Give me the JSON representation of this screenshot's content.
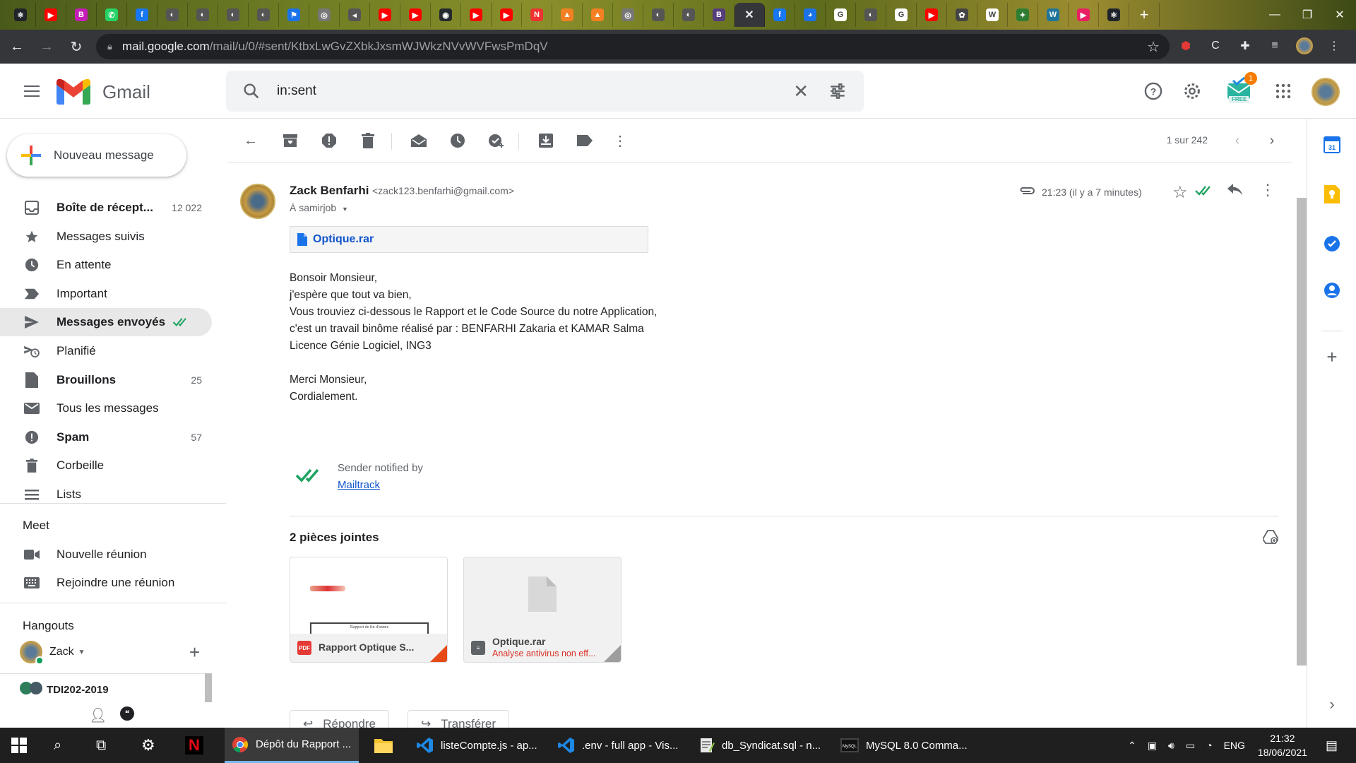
{
  "browser": {
    "tabs": [
      {
        "icon": "react-icon",
        "color": "#20232a",
        "glyph": "⚛"
      },
      {
        "icon": "youtube-icon",
        "color": "#ff0000",
        "glyph": "▶"
      },
      {
        "icon": "bootstrap-icon",
        "color": "#c51eb8",
        "glyph": "B"
      },
      {
        "icon": "whatsapp-icon",
        "color": "#25d366",
        "glyph": "✆"
      },
      {
        "icon": "facebook-icon",
        "color": "#1877f2",
        "glyph": "f"
      },
      {
        "icon": "globe-icon",
        "color": "#555",
        "glyph": "◐"
      },
      {
        "icon": "globe-icon",
        "color": "#555",
        "glyph": "◐"
      },
      {
        "icon": "globe-icon",
        "color": "#555",
        "glyph": "◐"
      },
      {
        "icon": "globe-icon",
        "color": "#555",
        "glyph": "◐"
      },
      {
        "icon": "flag-icon",
        "color": "#1a73e8",
        "glyph": "⚑"
      },
      {
        "icon": "globe-icon",
        "color": "#777",
        "glyph": "◎"
      },
      {
        "icon": "audio-icon",
        "color": "#555",
        "glyph": "◂"
      },
      {
        "icon": "youtube-icon",
        "color": "#ff0000",
        "glyph": "▶"
      },
      {
        "icon": "youtube-icon",
        "color": "#ff0000",
        "glyph": "▶"
      },
      {
        "icon": "github-icon",
        "color": "#24292e",
        "glyph": "◉"
      },
      {
        "icon": "youtube-icon",
        "color": "#ff0000",
        "glyph": "▶"
      },
      {
        "icon": "youtube-icon",
        "color": "#ff0000",
        "glyph": "▶"
      },
      {
        "icon": "news-icon",
        "color": "#e33",
        "glyph": "N"
      },
      {
        "icon": "stack-icon",
        "color": "#f48024",
        "glyph": "▲"
      },
      {
        "icon": "stack-icon",
        "color": "#f48024",
        "glyph": "▲"
      },
      {
        "icon": "globe-icon",
        "color": "#777",
        "glyph": "◎"
      },
      {
        "icon": "globe-icon",
        "color": "#555",
        "glyph": "◐"
      },
      {
        "icon": "globe-icon",
        "color": "#555",
        "glyph": "◐"
      },
      {
        "icon": "bootstrap-icon",
        "color": "#563d7c",
        "glyph": "B"
      }
    ],
    "active_tab_glyph": "✕",
    "tabs_right": [
      {
        "icon": "facebook-icon",
        "color": "#1877f2",
        "glyph": "f"
      },
      {
        "icon": "chrome-icon",
        "color": "#1a73e8",
        "glyph": "◕"
      },
      {
        "icon": "google-icon",
        "color": "#fff",
        "glyph": "G"
      },
      {
        "icon": "globe-icon",
        "color": "#555",
        "glyph": "◐"
      },
      {
        "icon": "google-icon",
        "color": "#fff",
        "glyph": "G"
      },
      {
        "icon": "youtube-icon",
        "color": "#ff0000",
        "glyph": "▶"
      },
      {
        "icon": "openai-icon",
        "color": "#444",
        "glyph": "✿"
      },
      {
        "icon": "wikipedia-icon",
        "color": "#fff",
        "glyph": "W"
      },
      {
        "icon": "leaf-icon",
        "color": "#2e7d32",
        "glyph": "✦"
      },
      {
        "icon": "wordpress-icon",
        "color": "#21759b",
        "glyph": "W"
      },
      {
        "icon": "play-icon",
        "color": "#e91e63",
        "glyph": "▶"
      },
      {
        "icon": "react-icon",
        "color": "#20232a",
        "glyph": "⚛"
      }
    ],
    "new_tab": "+",
    "url_host": "mail.google.com",
    "url_path": "/mail/u/0/#sent/KtbxLwGvZXbkJxsmWJWkzNVvWVFwsPmDqV"
  },
  "gmail": {
    "logo_text": "Gmail",
    "search_query": "in:sent",
    "addon_badge": "1",
    "addon_label": "FREE",
    "compose_label": "Nouveau message",
    "nav": [
      {
        "label": "Boîte de récept...",
        "count": "12 022",
        "bold": true,
        "icon": "inbox-icon"
      },
      {
        "label": "Messages suivis",
        "count": "",
        "bold": false,
        "icon": "star-icon"
      },
      {
        "label": "En attente",
        "count": "",
        "bold": false,
        "icon": "clock-icon"
      },
      {
        "label": "Important",
        "count": "",
        "bold": false,
        "icon": "important-icon"
      },
      {
        "label": "Messages envoyés",
        "count": "",
        "bold": true,
        "icon": "send-icon"
      },
      {
        "label": "Planifié",
        "count": "",
        "bold": false,
        "icon": "scheduled-icon"
      },
      {
        "label": "Brouillons",
        "count": "25",
        "bold": true,
        "icon": "draft-icon"
      },
      {
        "label": "Tous les messages",
        "count": "",
        "bold": false,
        "icon": "all-mail-icon"
      },
      {
        "label": "Spam",
        "count": "57",
        "bold": true,
        "icon": "spam-icon"
      },
      {
        "label": "Corbeille",
        "count": "",
        "bold": false,
        "icon": "trash-icon"
      },
      {
        "label": "Lists",
        "count": "",
        "bold": false,
        "icon": "list-icon"
      }
    ],
    "meet": {
      "title": "Meet",
      "new_meeting": "Nouvelle réunion",
      "join_meeting": "Rejoindre une réunion"
    },
    "hangouts": {
      "title": "Hangouts",
      "user": "Zack",
      "group": "TDI202-2019"
    },
    "pager": "1 sur 242",
    "message": {
      "sender_name": "Zack Benfarhi",
      "sender_email": "<zack123.benfarhi@gmail.com>",
      "to": "À samirjob",
      "time": "21:23 (il y a 7 minutes)",
      "inline_attachment": "Optique.rar",
      "body": [
        "Bonsoir Monsieur,",
        "j'espère que tout va bien,",
        "Vous trouviez ci-dessous le Rapport et le Code Source du notre Application,",
        "c'est un travail binôme réalisé par : BENFARHI Zakaria et KAMAR Salma",
        "Licence Génie Logiciel, ING3",
        "",
        "Merci Monsieur,",
        "Cordialement."
      ],
      "mailtrack_text": "Sender notified by",
      "mailtrack_link": "Mailtrack",
      "attachments_title": "2 pièces jointes",
      "attachments": [
        {
          "name": "Rapport Optique S...",
          "type": "PDF",
          "warning": "",
          "thumb_text": "Rapport de fin d'année"
        },
        {
          "name": "Optique.rar",
          "type": "RAR",
          "warning": "Analyse antivirus non eff..."
        }
      ],
      "reply_label": "Répondre",
      "forward_label": "Transférer"
    }
  },
  "taskbar": {
    "tasks": [
      {
        "label": "Dépôt du Rapport ...",
        "icon": "chrome-icon",
        "active": true
      },
      {
        "label": "",
        "icon": "folder-icon",
        "active": false
      },
      {
        "label": "listeCompte.js - ap...",
        "icon": "vscode-icon",
        "active": false
      },
      {
        "label": ".env - full app - Vis...",
        "icon": "vscode-icon",
        "active": false
      },
      {
        "label": "db_Syndicat.sql - n...",
        "icon": "notepad-icon",
        "active": false
      },
      {
        "label": "MySQL 8.0 Comma...",
        "icon": "mysql-icon",
        "active": false
      }
    ],
    "lang": "ENG",
    "time": "21:32",
    "date": "18/06/2021"
  }
}
